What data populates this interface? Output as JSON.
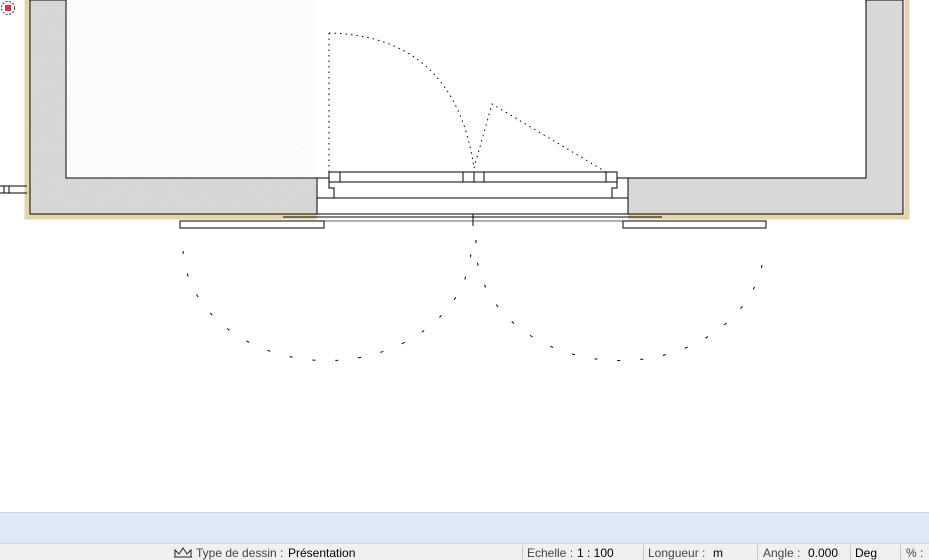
{
  "canvas": {
    "colors": {
      "concrete": "#d8d9d6",
      "insulation_border": "#e6d3a8",
      "line": "#000000",
      "background": "#ffffff",
      "snap_marker": "#e0304a"
    },
    "icons": [
      "snap-point-icon",
      "drawing-type-icon"
    ]
  },
  "status_bar": {
    "drawing_type_label": "Type de dessin :",
    "drawing_type_value": "Présentation",
    "scale_label": "Echelle :",
    "scale_value": "1 : 100",
    "length_label": "Longueur :",
    "length_value": "m",
    "angle_label": "Angle :",
    "angle_value": "0.000",
    "angle_unit": "Deg",
    "percent_label": "% :"
  }
}
